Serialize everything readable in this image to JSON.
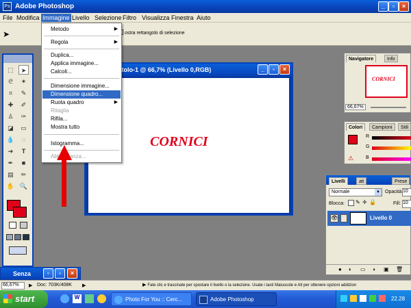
{
  "window": {
    "title": "Adobe Photoshop"
  },
  "menubar": [
    "File",
    "Modifica",
    "Immagine",
    "Livello",
    "Selezione",
    "Filtro",
    "Visualizza",
    "Finestra",
    "Aiuto"
  ],
  "options_hint": "ostra rettangolo di selezione",
  "dropdown": {
    "metodo": "Metodo",
    "regola": "Regola",
    "duplica": "Duplica...",
    "applica": "Applica immagine...",
    "calcoli": "Calcoli...",
    "dim_immagine": "Dimensione immagine...",
    "dim_quadro": "Dimensione quadro...",
    "ruota": "Ruota quadro",
    "ritaglia": "Ritaglia",
    "rifila": "Rifila...",
    "mostra": "Mostra tutto",
    "istogramma": "Istogramma...",
    "abbondanza": "Abbondanza..."
  },
  "document": {
    "title": "itolo-1 @ 66,7% (Livello 0,RGB)",
    "canvas_text": "CORNICI"
  },
  "navigator": {
    "tab1": "Navigatore",
    "tab2": "Info",
    "zoom": "66,67%",
    "thumb_text": "CORNICI"
  },
  "colors_panel": {
    "tab1": "Colori",
    "tab2": "Campioni",
    "tab3": "Stili",
    "r": "R",
    "g": "G",
    "b": "B"
  },
  "layers": {
    "tab1": "Livelli",
    "tab2": "ati",
    "tab3": "Prese",
    "mode": "Normale",
    "opacity_label": "Opacità:",
    "opacity_value": "10",
    "lock_label": "Blocca:",
    "fill_label": "Fill:",
    "fill_value": "10",
    "layer_name": "Livello 0"
  },
  "small_window": {
    "title": "Senza"
  },
  "status": {
    "zoom": "66,67%",
    "doc": "Doc: 703K/408K",
    "hint": "Fate clic e trascinate per spostare il livello o la selezione. Usate i tasti Maiuscole e Alt per ottenere opzioni addizion"
  },
  "taskbar": {
    "start": "start",
    "task1": "Photo For You :: Cerc...",
    "task2": "Adobe Photoshop",
    "clock": "22.28"
  },
  "accent": {
    "xp_blue": "#0842b8",
    "red": "#e60000",
    "highlight": "#316ac5"
  }
}
